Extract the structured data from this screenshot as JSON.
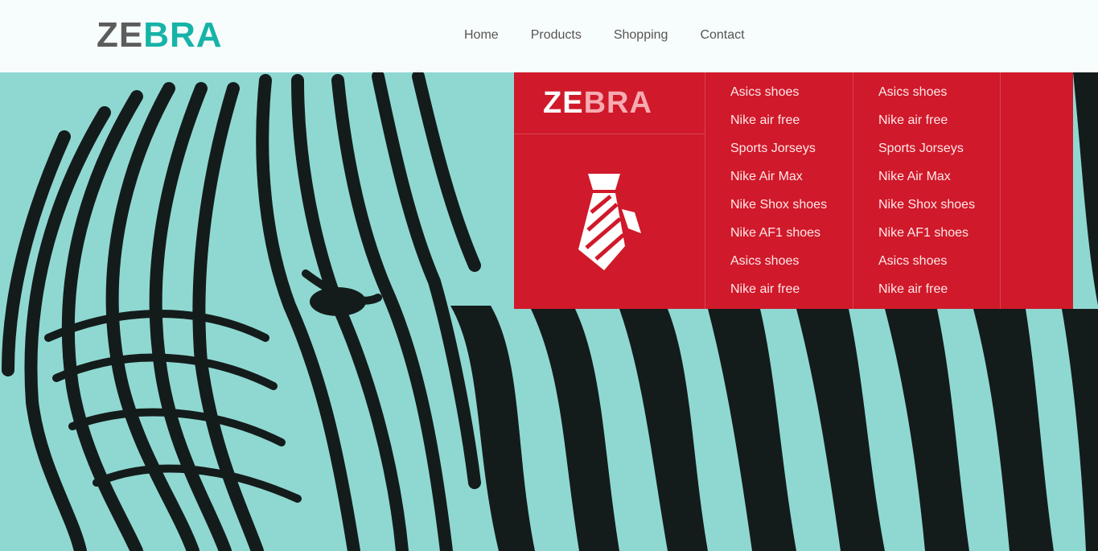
{
  "brand": {
    "logo_part1": "ZE",
    "logo_part2": "BRA",
    "primary_color": "#16b3a8",
    "dark_text_color": "#5c5c5c"
  },
  "nav": {
    "items": [
      {
        "label": "Home"
      },
      {
        "label": "Products"
      },
      {
        "label": "Shopping"
      },
      {
        "label": "Contact"
      }
    ]
  },
  "mega_menu": {
    "background_color": "#d0192a",
    "logo_part1": "ZE",
    "logo_part2": "BRA",
    "icon": "necktie-icon",
    "columns": [
      {
        "items": [
          {
            "label": "Asics shoes"
          },
          {
            "label": "Nike air free"
          },
          {
            "label": "Sports Jorseys"
          },
          {
            "label": "Nike Air Max"
          },
          {
            "label": "Nike Shox shoes"
          },
          {
            "label": "Nike AF1 shoes"
          },
          {
            "label": "Asics shoes"
          },
          {
            "label": "Nike air free"
          }
        ]
      },
      {
        "items": [
          {
            "label": "Asics shoes"
          },
          {
            "label": "Nike air free"
          },
          {
            "label": "Sports Jorseys"
          },
          {
            "label": "Nike Air Max"
          },
          {
            "label": "Nike Shox shoes"
          },
          {
            "label": "Nike AF1 shoes"
          },
          {
            "label": "Asics shoes"
          },
          {
            "label": "Nike air free"
          }
        ]
      }
    ]
  },
  "hero": {
    "image": "zebra-photo",
    "tint_color": "#8fd8d2"
  }
}
